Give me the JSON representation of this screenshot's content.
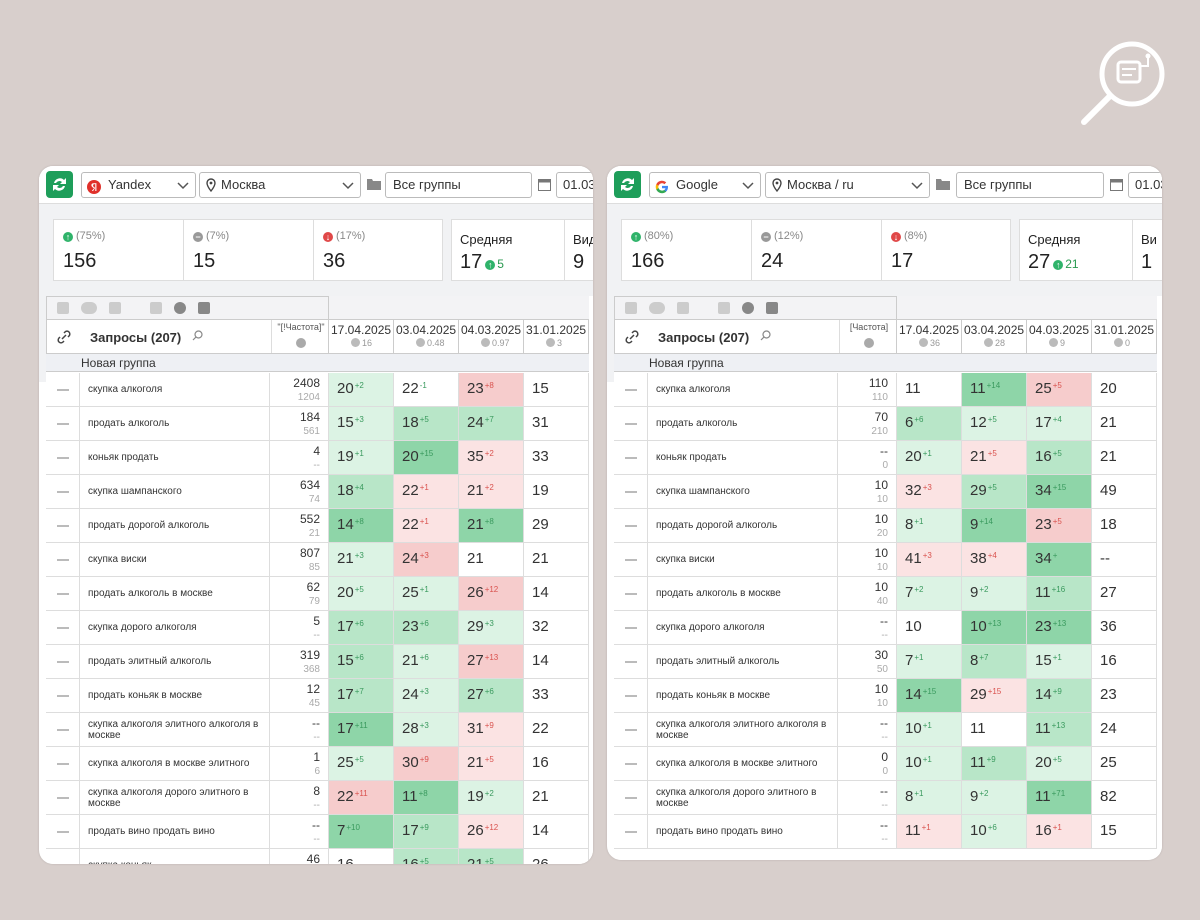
{
  "left": {
    "engine": "Yandex",
    "region": "Москва",
    "group_select": "Все группы",
    "date_from": "01.03.",
    "stats": {
      "up_pct": "(75%)",
      "up_val": "156",
      "same_pct": "(7%)",
      "same_val": "15",
      "down_pct": "(17%)",
      "down_val": "36",
      "avg_label": "Средняя",
      "avg_val": "17",
      "avg_delta": "5",
      "vis_label": "Вид",
      "vis_val": "9"
    },
    "queries_label": "Запросы (207)",
    "freq_label": "\"[!Частота]\"",
    "dates": [
      {
        "date": "17.04.2025",
        "sub": "16"
      },
      {
        "date": "03.04.2025",
        "sub": "0.48"
      },
      {
        "date": "04.03.2025",
        "sub": "0.97"
      },
      {
        "date": "31.01.2025",
        "sub": "3"
      }
    ],
    "group_name": "Новая группа",
    "rows": [
      {
        "q": "скупка алкоголя",
        "f1": "2408",
        "f2": "1204",
        "p": [
          [
            "20",
            "+2",
            "g1"
          ],
          [
            "22",
            "-1",
            "w"
          ],
          [
            "23",
            "+8",
            "r2"
          ],
          [
            "15",
            "",
            "w"
          ]
        ]
      },
      {
        "q": "продать алкоголь",
        "f1": "184",
        "f2": "561",
        "p": [
          [
            "15",
            "+3",
            "g1"
          ],
          [
            "18",
            "+5",
            "g2"
          ],
          [
            "24",
            "+7",
            "g2"
          ],
          [
            "31",
            "",
            "w"
          ]
        ]
      },
      {
        "q": "коньяк продать",
        "f1": "4",
        "f2": "--",
        "p": [
          [
            "19",
            "+1",
            "g1"
          ],
          [
            "20",
            "+15",
            "g3"
          ],
          [
            "35",
            "+2",
            "r1"
          ],
          [
            "33",
            "",
            "w"
          ]
        ]
      },
      {
        "q": "скупка шампанского",
        "f1": "634",
        "f2": "74",
        "p": [
          [
            "18",
            "+4",
            "g2"
          ],
          [
            "22",
            "+1",
            "r1"
          ],
          [
            "21",
            "+2",
            "r1"
          ],
          [
            "19",
            "",
            "w"
          ]
        ]
      },
      {
        "q": "продать дорогой алкоголь",
        "f1": "552",
        "f2": "21",
        "p": [
          [
            "14",
            "+8",
            "g3"
          ],
          [
            "22",
            "+1",
            "r1"
          ],
          [
            "21",
            "+8",
            "g3"
          ],
          [
            "29",
            "",
            "w"
          ]
        ]
      },
      {
        "q": "скупка виски",
        "f1": "807",
        "f2": "85",
        "p": [
          [
            "21",
            "+3",
            "g1"
          ],
          [
            "24",
            "+3",
            "r2"
          ],
          [
            "21",
            "",
            "w"
          ],
          [
            "21",
            "",
            "w"
          ]
        ]
      },
      {
        "q": "продать алкоголь в москве",
        "f1": "62",
        "f2": "79",
        "p": [
          [
            "20",
            "+5",
            "g1"
          ],
          [
            "25",
            "+1",
            "g1"
          ],
          [
            "26",
            "+12",
            "r2"
          ],
          [
            "14",
            "",
            "w"
          ]
        ]
      },
      {
        "q": "скупка дорого алкоголя",
        "f1": "5",
        "f2": "--",
        "p": [
          [
            "17",
            "+6",
            "g2"
          ],
          [
            "23",
            "+6",
            "g2"
          ],
          [
            "29",
            "+3",
            "g1"
          ],
          [
            "32",
            "",
            "w"
          ]
        ]
      },
      {
        "q": "продать элитный алкоголь",
        "f1": "319",
        "f2": "368",
        "p": [
          [
            "15",
            "+6",
            "g2"
          ],
          [
            "21",
            "+6",
            "g1"
          ],
          [
            "27",
            "+13",
            "r2"
          ],
          [
            "14",
            "",
            "w"
          ]
        ]
      },
      {
        "q": "продать коньяк в москве",
        "f1": "12",
        "f2": "45",
        "p": [
          [
            "17",
            "+7",
            "g2"
          ],
          [
            "24",
            "+3",
            "g1"
          ],
          [
            "27",
            "+6",
            "g2"
          ],
          [
            "33",
            "",
            "w"
          ]
        ]
      },
      {
        "q": "скупка алкоголя элитного алкоголя в москве",
        "f1": "--",
        "f2": "--",
        "p": [
          [
            "17",
            "+11",
            "g3"
          ],
          [
            "28",
            "+3",
            "g1"
          ],
          [
            "31",
            "+9",
            "r1"
          ],
          [
            "22",
            "",
            "w"
          ]
        ]
      },
      {
        "q": "скупка алкоголя в москве элитного",
        "f1": "1",
        "f2": "6",
        "p": [
          [
            "25",
            "+5",
            "g1"
          ],
          [
            "30",
            "+9",
            "r2"
          ],
          [
            "21",
            "+5",
            "r1"
          ],
          [
            "16",
            "",
            "w"
          ]
        ]
      },
      {
        "q": "скупка алкоголя дорого элитного в москве",
        "f1": "8",
        "f2": "--",
        "p": [
          [
            "22",
            "+11",
            "r2"
          ],
          [
            "11",
            "+8",
            "g3"
          ],
          [
            "19",
            "+2",
            "g1"
          ],
          [
            "21",
            "",
            "w"
          ]
        ]
      },
      {
        "q": "продать вино продать вино",
        "f1": "--",
        "f2": "--",
        "p": [
          [
            "7",
            "+10",
            "g3"
          ],
          [
            "17",
            "+9",
            "g2"
          ],
          [
            "26",
            "+12",
            "r1"
          ],
          [
            "14",
            "",
            "w"
          ]
        ]
      },
      {
        "q": "скупка коньяк",
        "f1": "46",
        "f2": "",
        "p": [
          [
            "16",
            "",
            "w"
          ],
          [
            "16",
            "+5",
            "g2"
          ],
          [
            "21",
            "+5",
            "g2"
          ],
          [
            "26",
            "",
            "w"
          ]
        ]
      }
    ]
  },
  "right": {
    "engine": "Google",
    "region": "Москва / ru",
    "group_select": "Все группы",
    "date_from": "01.03",
    "stats": {
      "up_pct": "(80%)",
      "up_val": "166",
      "same_pct": "(12%)",
      "same_val": "24",
      "down_pct": "(8%)",
      "down_val": "17",
      "avg_label": "Средняя",
      "avg_val": "27",
      "avg_delta": "21",
      "vis_label": "Ви",
      "vis_val": "1"
    },
    "queries_label": "Запросы (207)",
    "freq_label": "[Частота]",
    "dates": [
      {
        "date": "17.04.2025",
        "sub": "36"
      },
      {
        "date": "03.04.2025",
        "sub": "28"
      },
      {
        "date": "04.03.2025",
        "sub": "9"
      },
      {
        "date": "31.01.2025",
        "sub": "0"
      }
    ],
    "group_name": "Новая группа",
    "rows": [
      {
        "q": "скупка алкоголя",
        "f1": "110",
        "f2": "110",
        "p": [
          [
            "11",
            "",
            "w"
          ],
          [
            "11",
            "+14",
            "g3"
          ],
          [
            "25",
            "+5",
            "r2"
          ],
          [
            "20",
            "",
            "w"
          ]
        ]
      },
      {
        "q": "продать алкоголь",
        "f1": "70",
        "f2": "210",
        "p": [
          [
            "6",
            "+6",
            "g2"
          ],
          [
            "12",
            "+5",
            "g1"
          ],
          [
            "17",
            "+4",
            "g1"
          ],
          [
            "21",
            "",
            "w"
          ]
        ]
      },
      {
        "q": "коньяк продать",
        "f1": "--",
        "f2": "0",
        "p": [
          [
            "20",
            "+1",
            "g1"
          ],
          [
            "21",
            "+5",
            "r1"
          ],
          [
            "16",
            "+5",
            "g2"
          ],
          [
            "21",
            "",
            "w"
          ]
        ]
      },
      {
        "q": "скупка шампанского",
        "f1": "10",
        "f2": "10",
        "p": [
          [
            "32",
            "+3",
            "r1"
          ],
          [
            "29",
            "+5",
            "g2"
          ],
          [
            "34",
            "+15",
            "g3"
          ],
          [
            "49",
            "",
            "w"
          ]
        ]
      },
      {
        "q": "продать дорогой алкоголь",
        "f1": "10",
        "f2": "20",
        "p": [
          [
            "8",
            "+1",
            "g1"
          ],
          [
            "9",
            "+14",
            "g3"
          ],
          [
            "23",
            "+5",
            "r2"
          ],
          [
            "18",
            "",
            "w"
          ]
        ]
      },
      {
        "q": "скупка виски",
        "f1": "10",
        "f2": "10",
        "p": [
          [
            "41",
            "+3",
            "r1"
          ],
          [
            "38",
            "+4",
            "r1"
          ],
          [
            "34",
            "+",
            "g3"
          ],
          [
            "--",
            "",
            "w"
          ]
        ]
      },
      {
        "q": "продать алкоголь в москве",
        "f1": "10",
        "f2": "40",
        "p": [
          [
            "7",
            "+2",
            "g1"
          ],
          [
            "9",
            "+2",
            "g1"
          ],
          [
            "11",
            "+16",
            "g2"
          ],
          [
            "27",
            "",
            "w"
          ]
        ]
      },
      {
        "q": "скупка дорого алкоголя",
        "f1": "--",
        "f2": "--",
        "p": [
          [
            "10",
            "",
            "w"
          ],
          [
            "10",
            "+13",
            "g3"
          ],
          [
            "23",
            "+13",
            "g3"
          ],
          [
            "36",
            "",
            "w"
          ]
        ]
      },
      {
        "q": "продать элитный алкоголь",
        "f1": "30",
        "f2": "50",
        "p": [
          [
            "7",
            "+1",
            "g1"
          ],
          [
            "8",
            "+7",
            "g2"
          ],
          [
            "15",
            "+1",
            "g1"
          ],
          [
            "16",
            "",
            "w"
          ]
        ]
      },
      {
        "q": "продать коньяк в москве",
        "f1": "10",
        "f2": "10",
        "p": [
          [
            "14",
            "+15",
            "g3"
          ],
          [
            "29",
            "+15",
            "r1"
          ],
          [
            "14",
            "+9",
            "g2"
          ],
          [
            "23",
            "",
            "w"
          ]
        ]
      },
      {
        "q": "скупка алкоголя элитного алкоголя в москве",
        "f1": "--",
        "f2": "--",
        "p": [
          [
            "10",
            "+1",
            "g1"
          ],
          [
            "11",
            "",
            "w"
          ],
          [
            "11",
            "+13",
            "g2"
          ],
          [
            "24",
            "",
            "w"
          ]
        ]
      },
      {
        "q": "скупка алкоголя в москве элитного",
        "f1": "0",
        "f2": "0",
        "p": [
          [
            "10",
            "+1",
            "g1"
          ],
          [
            "11",
            "+9",
            "g2"
          ],
          [
            "20",
            "+5",
            "g1"
          ],
          [
            "25",
            "",
            "w"
          ]
        ]
      },
      {
        "q": "скупка алкоголя дорого элитного в москве",
        "f1": "--",
        "f2": "--",
        "p": [
          [
            "8",
            "+1",
            "g1"
          ],
          [
            "9",
            "+2",
            "g1"
          ],
          [
            "11",
            "+71",
            "g3"
          ],
          [
            "82",
            "",
            "w"
          ]
        ]
      },
      {
        "q": "продать вино продать вино",
        "f1": "--",
        "f2": "--",
        "p": [
          [
            "11",
            "+1",
            "r1"
          ],
          [
            "10",
            "+6",
            "g1"
          ],
          [
            "16",
            "+1",
            "r1"
          ],
          [
            "15",
            "",
            "w"
          ]
        ]
      }
    ]
  }
}
